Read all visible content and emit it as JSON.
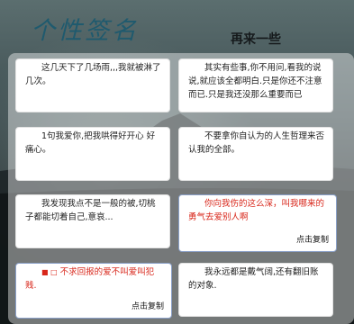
{
  "header": {
    "title": "个性签名",
    "subtitle": "再来一些"
  },
  "cards": [
    {
      "text": "这几天下了几场雨,,,我就被淋了几次。"
    },
    {
      "text": "其实有些事,你不用问,看我的说说,就应该全都明白.只是你还不注意而已.只是我还没那么重要而已"
    },
    {
      "text": "1句我爱你,把我哄得好开心 好痛心。"
    },
    {
      "text": "不要拿你自认为的人生哲理来否认我的全部。"
    },
    {
      "text": "我发现我点不是一般的被,切桃子都能切着自己,意哀..."
    },
    {
      "text": "你向我伤的这么深，叫我哪来的勇气去爱别人啊",
      "copy": "点击复制"
    },
    {
      "bullet": "■ □",
      "text": "不求回报的爱不叫爱叫犯贱.",
      "copy": "点击复制"
    },
    {
      "text": "我永远都是戴气阔,还有翻旧账的对象."
    }
  ]
}
